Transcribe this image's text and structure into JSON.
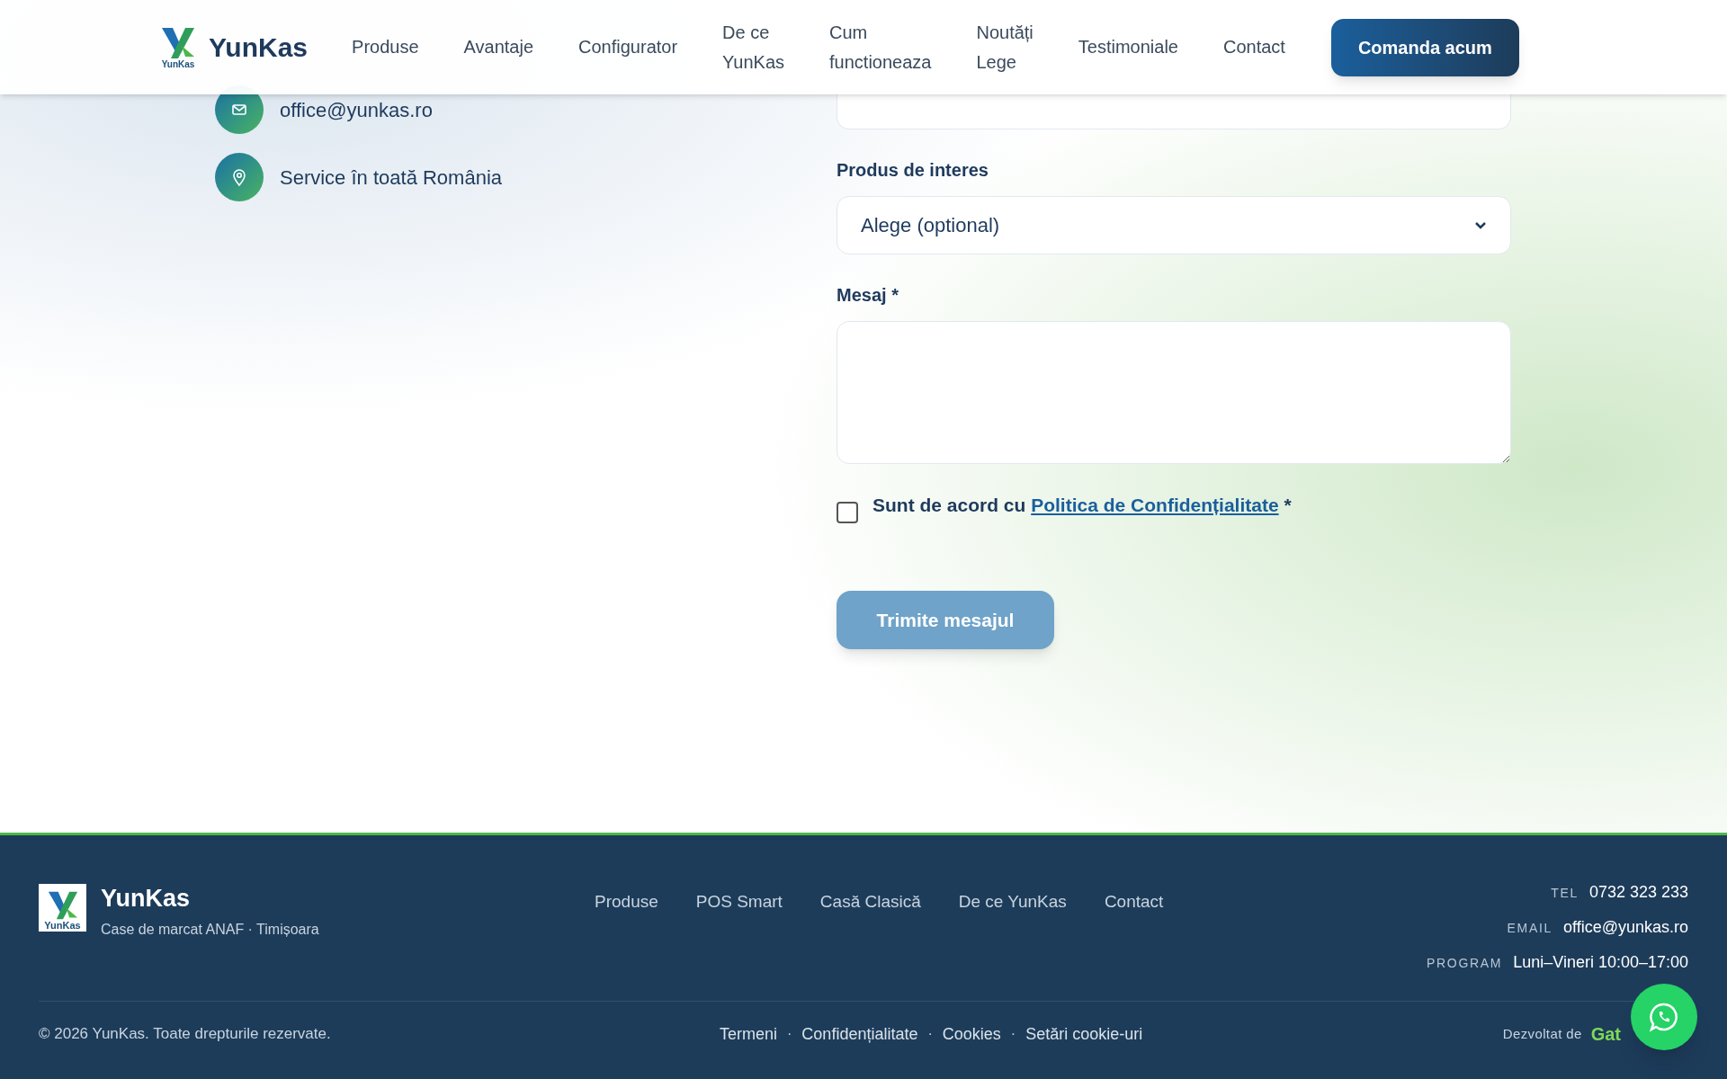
{
  "header": {
    "logo": {
      "text": "YunKas",
      "caption": "YunKas"
    },
    "nav": [
      "Produse",
      "Avantaje",
      "Configurator",
      "De ce YunKas",
      "Cum functioneaza",
      "Noutăți Lege",
      "Testimoniale",
      "Contact"
    ],
    "cta": "Comanda acum"
  },
  "contact_items": [
    {
      "kind": "email",
      "text": "office@yunkas.ro"
    },
    {
      "kind": "location",
      "text": "Service în toată România"
    }
  ],
  "form": {
    "product_label": "Produs de interes",
    "product_select": {
      "value": "Alege (optional)"
    },
    "message_label": "Mesaj *",
    "consent": {
      "checked": false,
      "text": "Sunt de acord cu",
      "link": "Politica de Confidențialitate",
      "required_mark": "*"
    },
    "submit": {
      "label": "Trimite mesajul",
      "disabled": true
    }
  },
  "footer": {
    "brand": {
      "name": "YunKas",
      "logo_caption": "YunKas",
      "tagline": "Case de marcat ANAF · Timișoara"
    },
    "links": [
      "Produse",
      "POS Smart",
      "Casă Clasică",
      "De ce YunKas",
      "Contact"
    ],
    "contacts": [
      {
        "label": "TEL",
        "value": "0732 323 233"
      },
      {
        "label": "EMAIL",
        "value": "office@yunkas.ro"
      },
      {
        "label": "PROGRAM",
        "value": "Luni–Vineri 10:00–17:00"
      }
    ],
    "copyright": "© 2026 YunKas. Toate drepturile rezervate.",
    "legal_links": [
      "Termeni",
      "Confidențialitate",
      "Cookies",
      "Setări cookie-uri"
    ],
    "separator": "·",
    "credit_label": "Dezvoltat de",
    "credit_name": "Gat"
  }
}
